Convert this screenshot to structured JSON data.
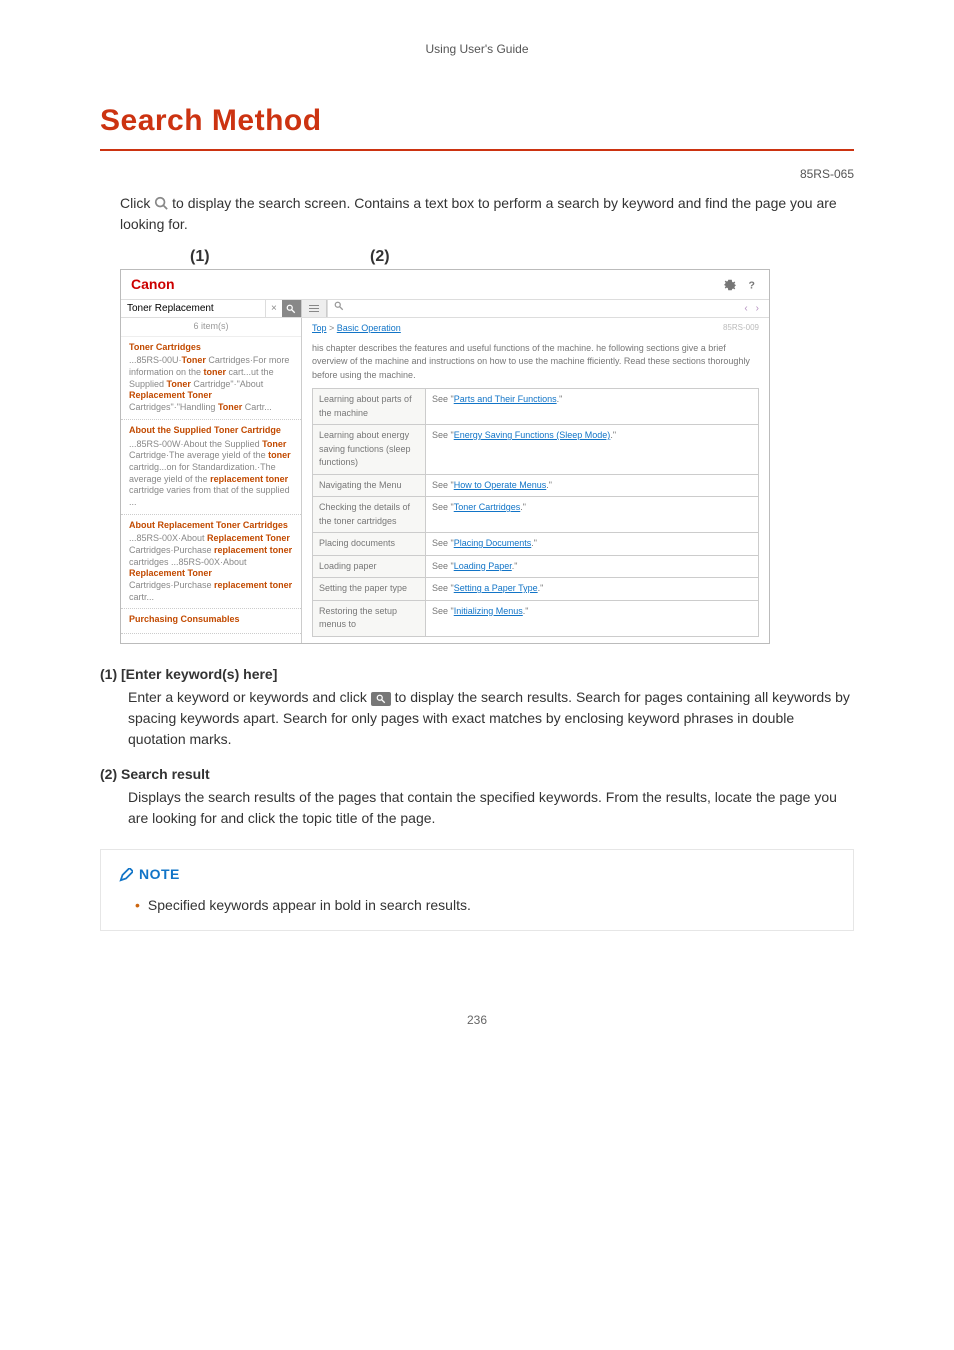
{
  "running_head": "Using User's Guide",
  "title": "Search Method",
  "doc_code": "85RS-065",
  "intro_pre": "Click ",
  "intro_post": " to display the search screen. Contains a text box to perform a search by keyword and find the page you are looking for.",
  "callouts": {
    "c1": "(1)",
    "c2": "(2)"
  },
  "app": {
    "logo_brand": "Canon",
    "search_value": "Toner Replacement",
    "items_count": "6 item(s)",
    "breadcrumb_top": "Top",
    "breadcrumb_sep": " > ",
    "breadcrumb_page": "Basic Operation",
    "page_code": "85RS-009",
    "blurb": "his chapter describes the features and useful functions of the machine. he following sections give a brief overview of the machine and instructions on how to use the machine fficiently. Read these sections thoroughly before using the machine.",
    "results": [
      {
        "title": "Toner Cartridges",
        "snippet": "...85RS-00U·<b>Toner</b> Cartridges·For more information on the <b>toner</b> cart...ut the Supplied <b>Toner</b> Cartridge\"·\"About <b>Replacement</b> <b>Toner</b> Cartridges\"·\"Handling <b>Toner</b> Cartr..."
      },
      {
        "title": "About the Supplied Toner Cartridge",
        "snippet": "...85RS-00W·About the Supplied <b>Toner</b> Cartridge·The average yield of the <b>toner</b> cartridg...on for Standardization.·The average yield of the <b>replacement</b> <b>toner</b> cartridge varies from that of the supplied ..."
      },
      {
        "title": "About Replacement Toner Cartridges",
        "snippet": "...85RS-00X·About <b>Replacement</b> <b>Toner</b> Cartridges·Purchase <b>replacement</b> <b>toner</b> cartridges ...85RS-00X·About <b>Replacement</b> <b>Toner</b> Cartridges·Purchase <b>replacement</b> <b>toner</b> cartr..."
      },
      {
        "title": "Purchasing Consumables",
        "snippet": ""
      }
    ],
    "table": [
      {
        "label": "Learning about parts of the machine",
        "pre": "See \"",
        "link": "Parts and Their Functions",
        "post": ".\""
      },
      {
        "label": "Learning about energy saving functions (sleep functions)",
        "pre": "See \"",
        "link": "Energy Saving Functions (Sleep Mode)",
        "post": ".\""
      },
      {
        "label": "Navigating the Menu",
        "pre": "See \"",
        "link": "How to Operate Menus",
        "post": ".\""
      },
      {
        "label": "Checking the details of the toner cartridges",
        "pre": "See \"",
        "link": "Toner Cartridges",
        "post": ".\""
      },
      {
        "label": "Placing documents",
        "pre": "See \"",
        "link": "Placing Documents",
        "post": ".\""
      },
      {
        "label": "Loading paper",
        "pre": "See \"",
        "link": "Loading Paper",
        "post": ".\""
      },
      {
        "label": "Setting the paper type",
        "pre": "See \"",
        "link": "Setting a Paper Type",
        "post": ".\""
      },
      {
        "label": "Restoring the setup menus to",
        "pre": "See \"",
        "link": "Initializing Menus",
        "post": ".\""
      }
    ]
  },
  "defs": {
    "d1_head": "(1) [Enter keyword(s) here]",
    "d1_pre": "Enter a keyword or keywords and click ",
    "d1_post": " to display the search results. Search for pages containing all keywords by spacing keywords apart. Search for only pages with exact matches by enclosing keyword phrases in double quotation marks.",
    "d2_head": "(2) Search result",
    "d2_body": "Displays the search results of the pages that contain the specified keywords. From the results, locate the page you are looking for and click the topic title of the page."
  },
  "note": {
    "label": "NOTE",
    "item": "Specified keywords appear in bold in search results."
  },
  "page_number": "236"
}
